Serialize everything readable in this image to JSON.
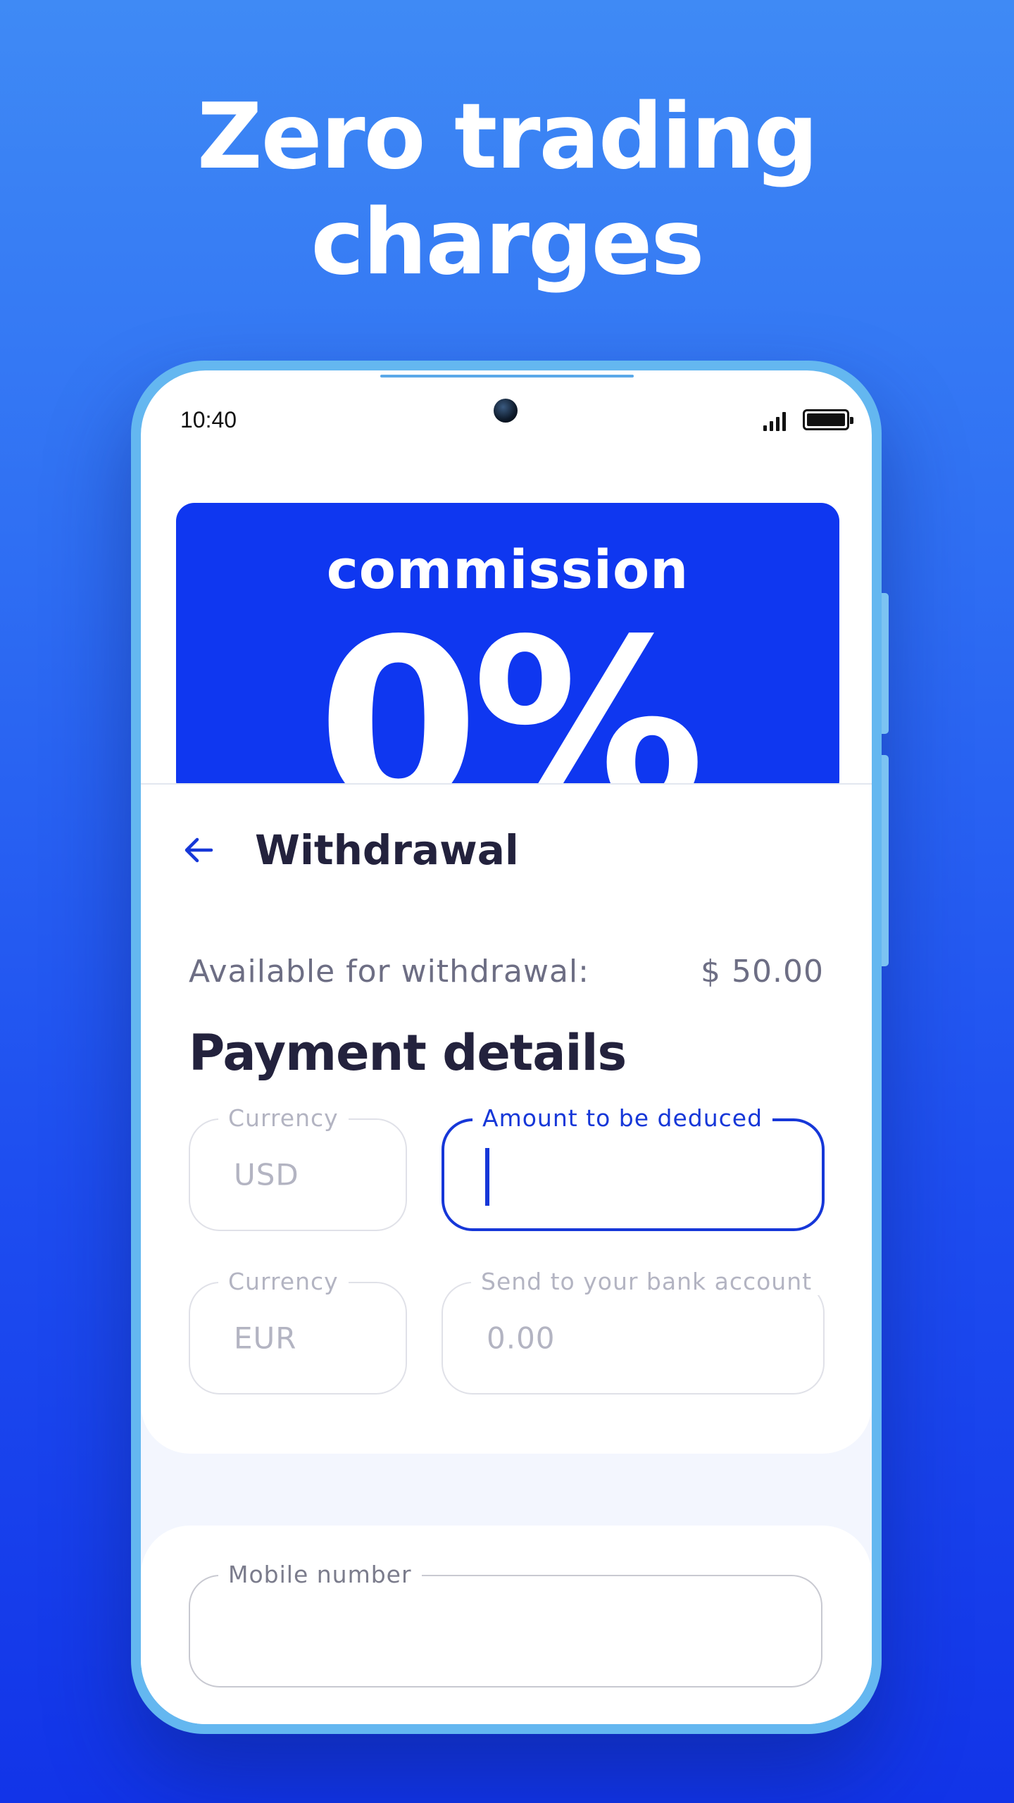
{
  "promo": {
    "headline_line1": "Zero trading",
    "headline_line2": "charges"
  },
  "status_bar": {
    "time": "10:40",
    "signal_icon": "signal-icon",
    "battery_icon": "battery-icon"
  },
  "banner": {
    "label": "commission",
    "value": "0%",
    "color": "#0f37f0"
  },
  "header": {
    "back_icon": "arrow-left-icon",
    "title": "Withdrawal"
  },
  "balance": {
    "label": "Available for withdrawal:",
    "value": "$ 50.00"
  },
  "payment": {
    "title": "Payment details",
    "fields": [
      {
        "label": "Currency",
        "value": "USD"
      },
      {
        "label": "Amount to be deduced",
        "value": ""
      },
      {
        "label": "Currency",
        "value": "EUR"
      },
      {
        "label": "Send to your bank account",
        "value": "0.00"
      }
    ]
  },
  "contact": {
    "mobile_label": "Mobile number",
    "mobile_value": ""
  },
  "colors": {
    "accent": "#1637d8",
    "text_dark": "#23223d",
    "text_muted": "#6d6e84"
  }
}
